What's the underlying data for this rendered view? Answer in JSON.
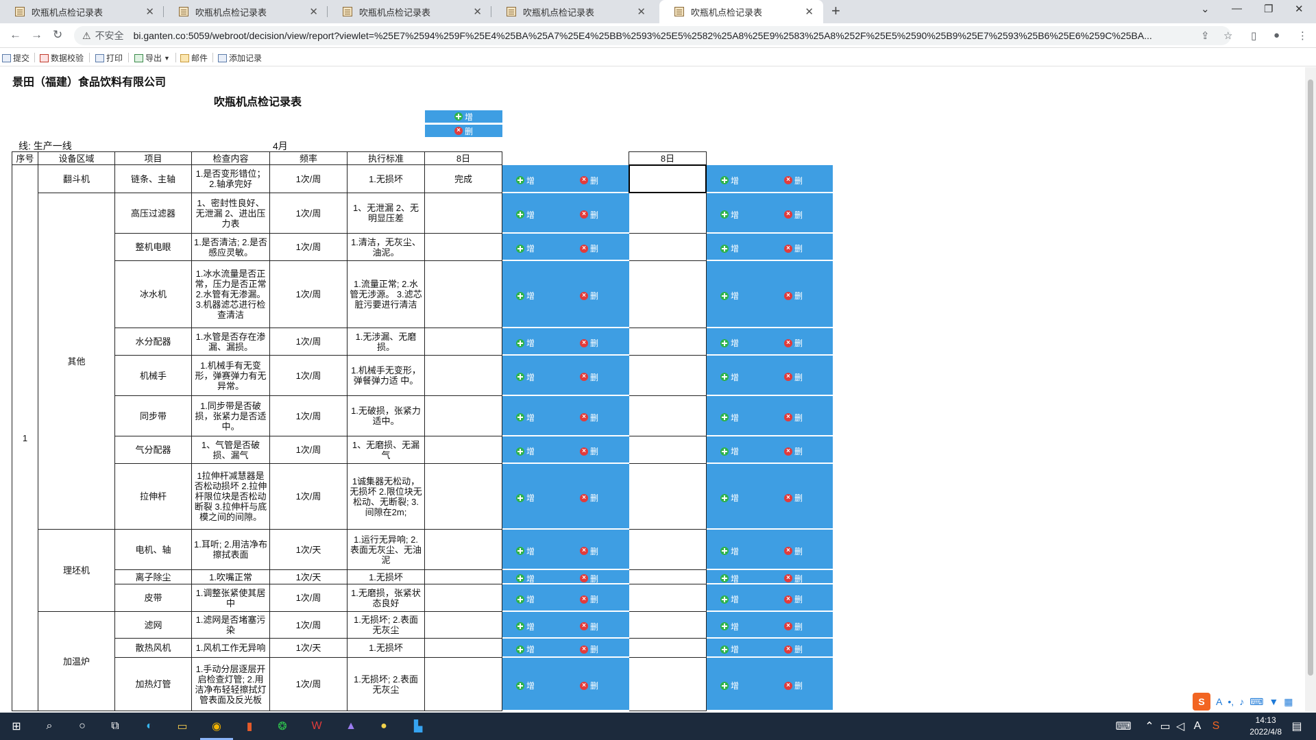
{
  "browser": {
    "tabs": [
      {
        "title": "吹瓶机点检记录表"
      },
      {
        "title": "吹瓶机点检记录表"
      },
      {
        "title": "吹瓶机点检记录表"
      },
      {
        "title": "吹瓶机点检记录表"
      },
      {
        "title": "吹瓶机点检记录表"
      }
    ],
    "insecure_label": "不安全",
    "url": "bi.ganten.co:5059/webroot/decision/view/report?viewlet=%25E7%2594%259F%25E4%25BA%25A7%25E4%25BB%2593%25E5%2582%25A8%25E9%2583%25A8%252F%25E5%2590%25B9%25E7%2593%25B6%25E6%259C%25BA..."
  },
  "toolbar": {
    "submit": "提交",
    "validate": "数据校验",
    "print": "打印",
    "export": "导出",
    "mail": "邮件",
    "add_record": "添加记录"
  },
  "report": {
    "company": "景田（福建）食品饮料有限公司",
    "title": "吹瓶机点检记录表",
    "add_label": "增",
    "del_label": "删",
    "line_label": "线:  生产一线",
    "month": "4月",
    "headers": [
      "序号",
      "设备区域",
      "项目",
      "检查内容",
      "频率",
      "执行标准",
      "8日"
    ],
    "extra_header": "8日",
    "seq": "1",
    "areas": [
      "翻斗机",
      "其他",
      "理坯机",
      "加温炉"
    ],
    "rows": [
      {
        "item": "链条、主轴",
        "content": "1.是否变形错位；2.轴承完好",
        "freq": "1次/周",
        "std": "1.无损坏",
        "day8": "完成"
      },
      {
        "item": "高压过滤器",
        "content": "1、密封性良好、无泄漏 2、进出压力表",
        "freq": "1次/周",
        "std": "1、无泄漏 2、无明显压差",
        "day8": ""
      },
      {
        "item": "整机电眼",
        "content": "1.是否清洁; 2.是否感应灵敏。",
        "freq": "1次/周",
        "std": "1.清洁，无灰尘、油泥。",
        "day8": ""
      },
      {
        "item": "冰水机",
        "content": "1.冰水流量是否正常，压力是否正常 2.水管有无渗漏。3.机器滤芯进行检查清洁",
        "freq": "1次/周",
        "std": "1.流量正常; 2.水管无涉源。 3.滤芯脏污要进行清洁",
        "day8": ""
      },
      {
        "item": "水分配器",
        "content": "1.水管是否存在渗漏、漏损。",
        "freq": "1次/周",
        "std": "1.无涉漏、无磨损。",
        "day8": ""
      },
      {
        "item": "机械手",
        "content": "1.机械手有无变形，弹赛弹力有无异常。",
        "freq": "1次/周",
        "std": "1.机械手无变形，弹餐弹力适 中。",
        "day8": ""
      },
      {
        "item": "同步带",
        "content": "1.同步带是否破损，张紧力是否适中。",
        "freq": "1次/周",
        "std": "1.无破损，张紧力适中。",
        "day8": ""
      },
      {
        "item": "气分配器",
        "content": "1、气管是否破损、漏气",
        "freq": "1次/周",
        "std": "1、无磨损、无漏气",
        "day8": ""
      },
      {
        "item": "拉伸杆",
        "content": "1拉伸杆减慧器是否松动损坏 2.拉伸杆限位块是否松动断裂 3.拉伸杆与底模之间的间隙。",
        "freq": "1次/周",
        "std": "1诚集器无松动，无损坏 2.限位块无松动、无断裂; 3.间隙在2m;",
        "day8": ""
      },
      {
        "item": "电机、轴",
        "content": "1.耳听; 2.用洁净布擦拭表面",
        "freq": "1次/天",
        "std": "1.运行无异响; 2.表面无灰尘、无油泥",
        "day8": ""
      },
      {
        "item": "离子除尘",
        "content": "1.吹嘴正常",
        "freq": "1次/天",
        "std": "1.无损坏",
        "day8": ""
      },
      {
        "item": "皮带",
        "content": "1.调整张紧使其居中",
        "freq": "1次/周",
        "std": "1.无磨损，张紧状态良好",
        "day8": ""
      },
      {
        "item": "滤网",
        "content": "1.滤网是否堵塞污染",
        "freq": "1次/周",
        "std": "1.无损坏; 2.表面无灰尘",
        "day8": ""
      },
      {
        "item": "散热风机",
        "content": "1.风机工作无异响",
        "freq": "1次/天",
        "std": "1.无损坏",
        "day8": ""
      },
      {
        "item": "加热灯管",
        "content": "1.手动分层逐层开启检查灯管; 2.用洁净布轻轻擦拭灯管表面及反光板",
        "freq": "1次/周",
        "std": "1.无损坏; 2.表面无灰尘",
        "day8": ""
      }
    ]
  },
  "taskbar": {
    "time": "14:13",
    "date": "2022/4/8"
  },
  "colors": {
    "button_blue": "#3e9ee3",
    "plus_green": "#2eb34a",
    "del_red": "#e23b3b",
    "taskbar": "#1c2a3c"
  }
}
